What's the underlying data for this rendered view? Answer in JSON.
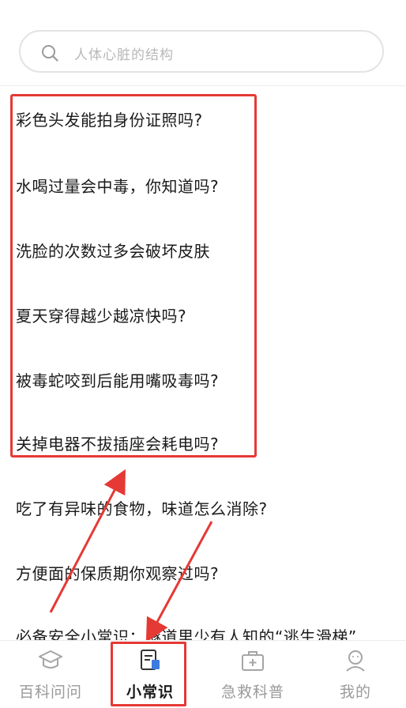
{
  "search": {
    "placeholder": "人体心脏的结构"
  },
  "list": {
    "items": [
      "彩色头发能拍身份证照吗?",
      "水喝过量会中毒，你知道吗?",
      "洗脸的次数过多会破坏皮肤",
      "夏天穿得越少越凉快吗?",
      "被毒蛇咬到后能用嘴吸毒吗?",
      "关掉电器不拔插座会耗电吗?",
      "吃了有异味的食物，味道怎么消除?",
      "方便面的保质期你观察过吗?",
      "必备安全小常识：隧道里少有人知的“逃生滑梯”"
    ]
  },
  "bottom_nav": {
    "items": [
      {
        "label": "百科问问",
        "icon": "graduation-cap-icon",
        "active": false
      },
      {
        "label": "小常识",
        "icon": "document-icon",
        "active": true
      },
      {
        "label": "急救科普",
        "icon": "first-aid-kit-icon",
        "active": false
      },
      {
        "label": "我的",
        "icon": "user-icon",
        "active": false
      }
    ]
  },
  "colors": {
    "annotation_red": "#e53935",
    "active_icon_blue": "#3d7be0",
    "inactive_gray": "#9a9a9a"
  }
}
